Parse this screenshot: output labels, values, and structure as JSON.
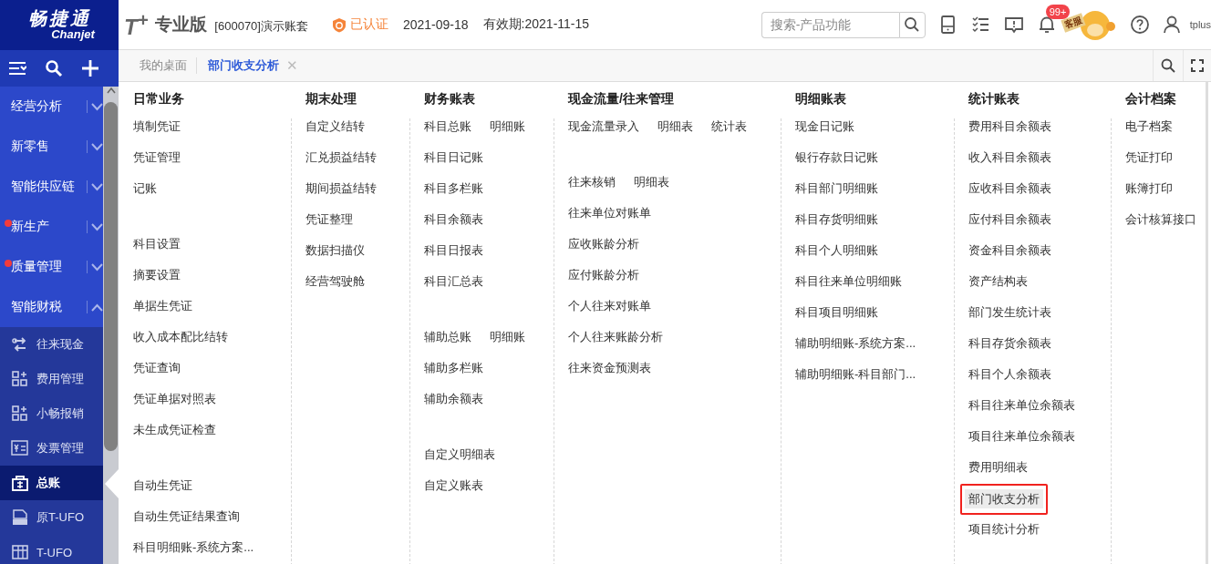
{
  "header": {
    "logo": {
      "name": "畅捷通",
      "sub": "Chanjet"
    },
    "product": {
      "mark": "T$^{+}$",
      "edition": "专业版"
    },
    "account": "[600070]演示账套",
    "certified": {
      "label": "已认证"
    },
    "date": "2021-09-18",
    "validity": "有效期:2021-11-15",
    "search": {
      "placeholder": "搜索-产品功能"
    },
    "notifications": {
      "badge": "99+"
    },
    "service": "客服",
    "user": "tplus"
  },
  "tabs": [
    {
      "label": "我的桌面",
      "selected": false
    },
    {
      "label": "部门收支分析",
      "selected": true,
      "close": "✕"
    }
  ],
  "sidebar": {
    "items": [
      {
        "label": "经营分析",
        "expanded": false,
        "dot": false
      },
      {
        "label": "新零售",
        "expanded": false,
        "dot": false
      },
      {
        "label": "智能供应链",
        "expanded": false,
        "dot": false
      },
      {
        "label": "新生产",
        "expanded": false,
        "dot": true
      },
      {
        "label": "质量管理",
        "expanded": false,
        "dot": true
      },
      {
        "label": "智能财税",
        "expanded": true,
        "dot": false,
        "children": [
          {
            "label": "往来现金",
            "kind": "exchange",
            "selected": false
          },
          {
            "label": "费用管理",
            "kind": "grid",
            "selected": false
          },
          {
            "label": "小畅报销",
            "kind": "grid",
            "selected": false
          },
          {
            "label": "发票管理",
            "kind": "invoice",
            "selected": false
          },
          {
            "label": "总账",
            "kind": "ledger",
            "selected": true
          },
          {
            "label": "原T-UFO",
            "kind": "file",
            "selected": false
          },
          {
            "label": "T-UFO",
            "kind": "table",
            "selected": false
          }
        ]
      }
    ]
  },
  "menu": {
    "columns": [
      {
        "title": "日常业务",
        "groups": [
          [
            [
              {
                "label": "填制凭证",
                "selected": false
              }
            ],
            [
              {
                "label": "凭证管理",
                "selected": false
              }
            ],
            [
              {
                "label": "记账",
                "selected": false
              }
            ]
          ],
          [
            [
              {
                "label": "科目设置",
                "selected": false
              }
            ],
            [
              {
                "label": "摘要设置",
                "selected": false
              }
            ],
            [
              {
                "label": "单据生凭证",
                "selected": false
              }
            ],
            [
              {
                "label": "收入成本配比结转",
                "selected": false
              }
            ],
            [
              {
                "label": "凭证查询",
                "selected": false
              }
            ],
            [
              {
                "label": "凭证单据对照表",
                "selected": false
              }
            ],
            [
              {
                "label": "未生成凭证检查",
                "selected": false
              }
            ]
          ],
          [
            [
              {
                "label": "自动生凭证",
                "selected": false
              }
            ],
            [
              {
                "label": "自动生凭证结果查询",
                "selected": false
              }
            ],
            [
              {
                "label": "科目明细账-系统方案...",
                "selected": false
              }
            ]
          ]
        ]
      },
      {
        "title": "期末处理",
        "groups": [
          [
            [
              {
                "label": "自定义结转",
                "selected": false
              }
            ],
            [
              {
                "label": "汇兑损益结转",
                "selected": false
              }
            ],
            [
              {
                "label": "期间损益结转",
                "selected": false
              }
            ],
            [
              {
                "label": "凭证整理",
                "selected": false
              }
            ],
            [
              {
                "label": "数据扫描仪",
                "selected": false
              }
            ],
            [
              {
                "label": "经营驾驶舱",
                "selected": false
              }
            ]
          ]
        ]
      },
      {
        "title": "财务账表",
        "groups": [
          [
            [
              {
                "label": "科目总账",
                "selected": false
              },
              {
                "label": "明细账",
                "selected": false
              }
            ],
            [
              {
                "label": "科目日记账",
                "selected": false
              }
            ],
            [
              {
                "label": "科目多栏账",
                "selected": false
              }
            ],
            [
              {
                "label": "科目余额表",
                "selected": false
              }
            ],
            [
              {
                "label": "科目日报表",
                "selected": false
              }
            ],
            [
              {
                "label": "科目汇总表",
                "selected": false
              }
            ]
          ],
          [
            [
              {
                "label": "辅助总账",
                "selected": false
              },
              {
                "label": "明细账",
                "selected": false
              }
            ],
            [
              {
                "label": "辅助多栏账",
                "selected": false
              }
            ],
            [
              {
                "label": "辅助余额表",
                "selected": false
              }
            ]
          ],
          [
            [
              {
                "label": "自定义明细表",
                "selected": false
              }
            ],
            [
              {
                "label": "自定义账表",
                "selected": false
              }
            ]
          ]
        ]
      },
      {
        "title": "现金流量/往来管理",
        "groups": [
          [
            [
              {
                "label": "现金流量录入",
                "selected": false
              },
              {
                "label": "明细表",
                "selected": false
              },
              {
                "label": "统计表",
                "selected": false
              }
            ]
          ],
          [
            [
              {
                "label": "往来核销",
                "selected": false
              },
              {
                "label": "明细表",
                "selected": false
              }
            ],
            [
              {
                "label": "往来单位对账单",
                "selected": false
              }
            ],
            [
              {
                "label": "应收账龄分析",
                "selected": false
              }
            ],
            [
              {
                "label": "应付账龄分析",
                "selected": false
              }
            ],
            [
              {
                "label": "个人往来对账单",
                "selected": false
              }
            ],
            [
              {
                "label": "个人往来账龄分析",
                "selected": false
              }
            ],
            [
              {
                "label": "往来资金预测表",
                "selected": false
              }
            ]
          ]
        ]
      },
      {
        "title": "明细账表",
        "groups": [
          [
            [
              {
                "label": "现金日记账",
                "selected": false
              }
            ],
            [
              {
                "label": "银行存款日记账",
                "selected": false
              }
            ],
            [
              {
                "label": "科目部门明细账",
                "selected": false
              }
            ],
            [
              {
                "label": "科目存货明细账",
                "selected": false
              }
            ],
            [
              {
                "label": "科目个人明细账",
                "selected": false
              }
            ],
            [
              {
                "label": "科目往来单位明细账",
                "selected": false
              }
            ],
            [
              {
                "label": "科目项目明细账",
                "selected": false
              }
            ],
            [
              {
                "label": "辅助明细账-系统方案...",
                "selected": false
              }
            ],
            [
              {
                "label": "辅助明细账-科目部门...",
                "selected": false
              }
            ]
          ]
        ]
      },
      {
        "title": "统计账表",
        "groups": [
          [
            [
              {
                "label": "费用科目余额表",
                "selected": false
              }
            ],
            [
              {
                "label": "收入科目余额表",
                "selected": false
              }
            ],
            [
              {
                "label": "应收科目余额表",
                "selected": false
              }
            ],
            [
              {
                "label": "应付科目余额表",
                "selected": false
              }
            ],
            [
              {
                "label": "资金科目余额表",
                "selected": false
              }
            ],
            [
              {
                "label": "资产结构表",
                "selected": false
              }
            ],
            [
              {
                "label": "部门发生统计表",
                "selected": false
              }
            ],
            [
              {
                "label": "科目存货余额表",
                "selected": false
              }
            ],
            [
              {
                "label": "科目个人余额表",
                "selected": false
              }
            ],
            [
              {
                "label": "科目往来单位余额表",
                "selected": false
              }
            ],
            [
              {
                "label": "项目往来单位余额表",
                "selected": false
              }
            ],
            [
              {
                "label": "费用明细表",
                "selected": false
              }
            ],
            [
              {
                "label": "部门收支分析",
                "selected": true
              }
            ],
            [
              {
                "label": "项目统计分析",
                "selected": false
              }
            ]
          ]
        ]
      },
      {
        "title": "会计档案",
        "groups": [
          [
            [
              {
                "label": "电子档案",
                "selected": false
              }
            ],
            [
              {
                "label": "凭证打印",
                "selected": false
              }
            ],
            [
              {
                "label": "账簿打印",
                "selected": false
              }
            ],
            [
              {
                "label": "会计核算接口",
                "selected": false
              }
            ]
          ]
        ]
      }
    ]
  }
}
